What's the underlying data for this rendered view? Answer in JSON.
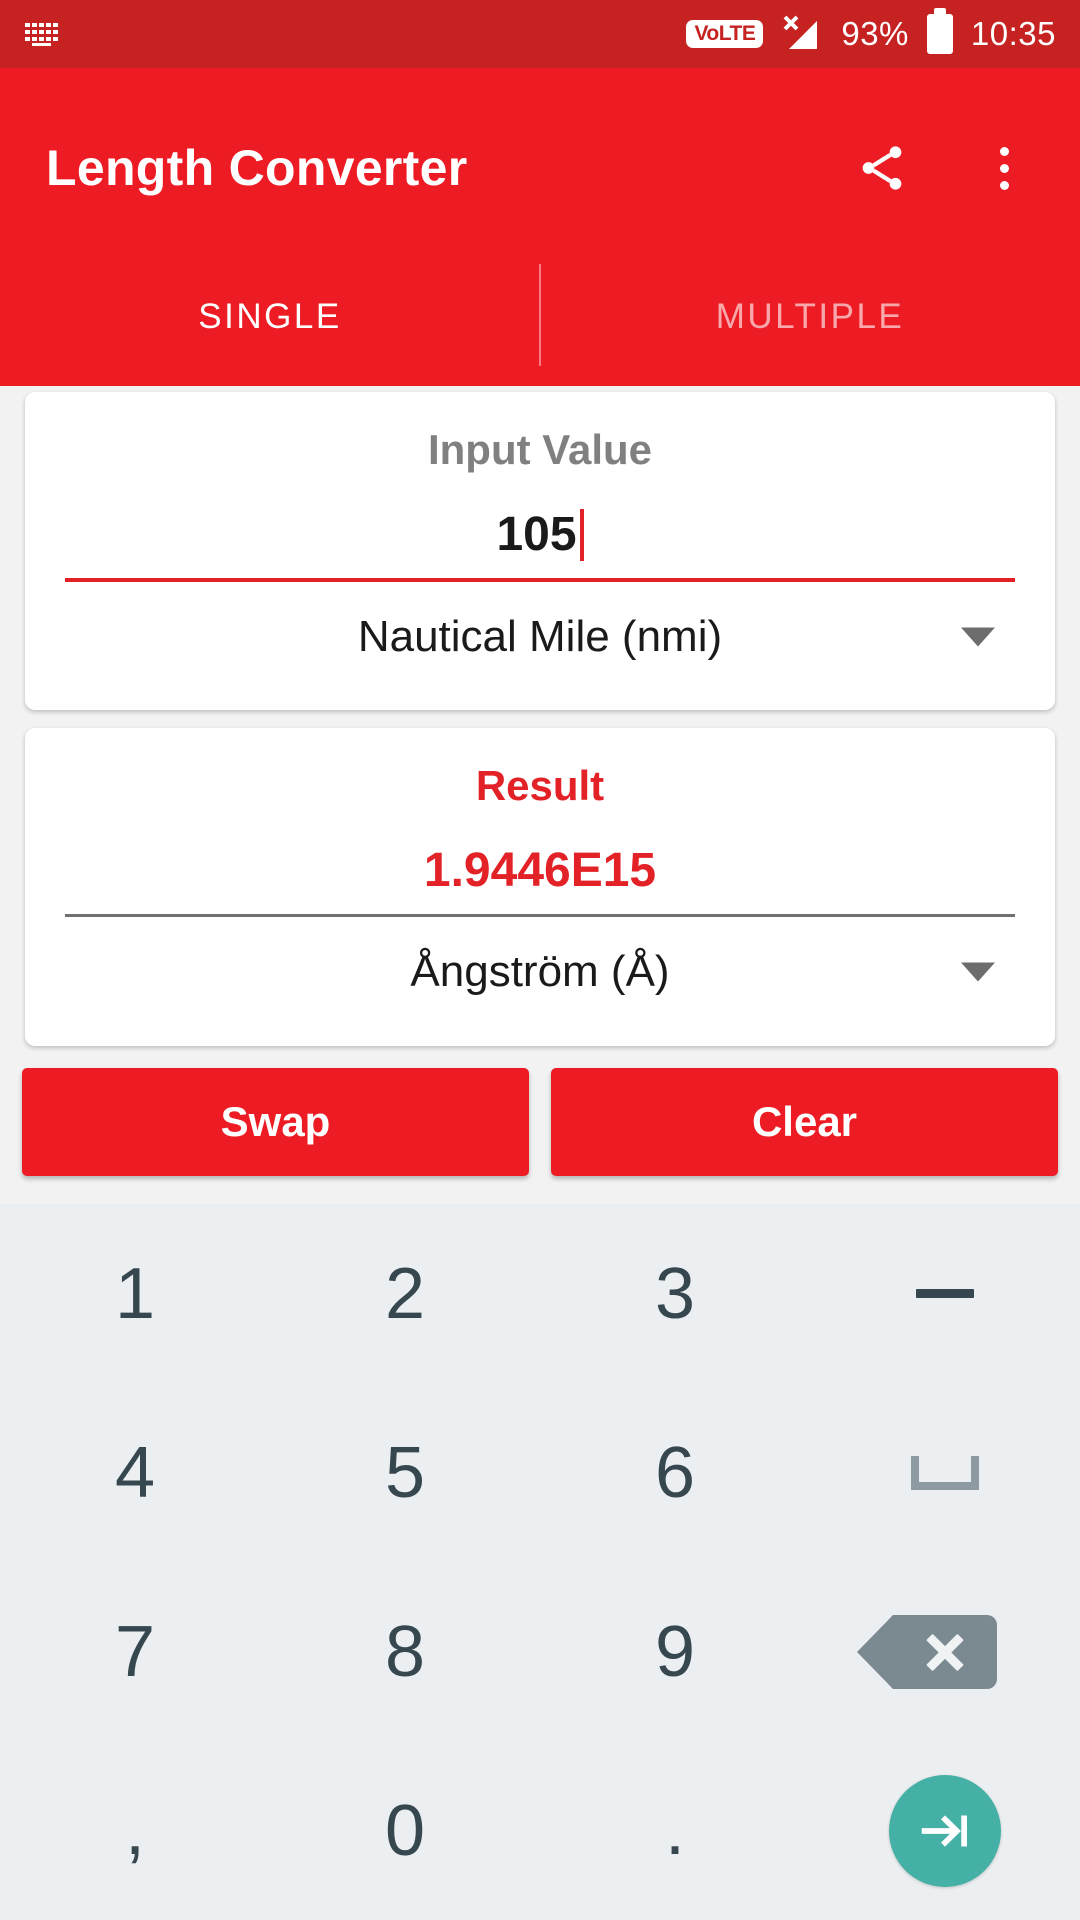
{
  "statusbar": {
    "keyboard_icon": "keyboard-icon",
    "volte_label": "VoLTE",
    "signal_icon": "signal-no-service-icon",
    "battery_percent": "93%",
    "battery_icon": "battery-icon",
    "clock": "10:35"
  },
  "appbar": {
    "title": "Length Converter",
    "share_icon": "share-icon",
    "overflow_icon": "overflow-menu-icon"
  },
  "tabs": [
    {
      "label": "SINGLE",
      "active": true
    },
    {
      "label": "MULTIPLE",
      "active": false
    }
  ],
  "input_card": {
    "label": "Input Value",
    "value": "105",
    "unit": "Nautical Mile (nmi)",
    "dropdown_icon": "chevron-down-icon"
  },
  "result_card": {
    "label": "Result",
    "value": "1.9446E15",
    "unit": "Ångström (Å)",
    "dropdown_icon": "chevron-down-icon"
  },
  "actions": {
    "swap_label": "Swap",
    "clear_label": "Clear"
  },
  "keyboard": {
    "rows": [
      [
        {
          "label": "1",
          "type": "digit"
        },
        {
          "label": "2",
          "type": "digit"
        },
        {
          "label": "3",
          "type": "digit"
        },
        {
          "label": "-",
          "type": "dash"
        }
      ],
      [
        {
          "label": "4",
          "type": "digit"
        },
        {
          "label": "5",
          "type": "digit"
        },
        {
          "label": "6",
          "type": "digit"
        },
        {
          "label": "",
          "type": "space"
        }
      ],
      [
        {
          "label": "7",
          "type": "digit"
        },
        {
          "label": "8",
          "type": "digit"
        },
        {
          "label": "9",
          "type": "digit"
        },
        {
          "label": "",
          "type": "backspace"
        }
      ],
      [
        {
          "label": ",",
          "type": "comma"
        },
        {
          "label": "0",
          "type": "digit"
        },
        {
          "label": ".",
          "type": "period"
        },
        {
          "label": "",
          "type": "enter"
        }
      ]
    ]
  },
  "colors": {
    "statusbar": "#c62222",
    "primary_red": "#ed1c24",
    "accent_red": "#e32227",
    "keyboard_bg": "#eceff1",
    "key_text": "#37474f",
    "enter_teal": "#45b0a5",
    "backspace_gray": "#7b8a90"
  }
}
